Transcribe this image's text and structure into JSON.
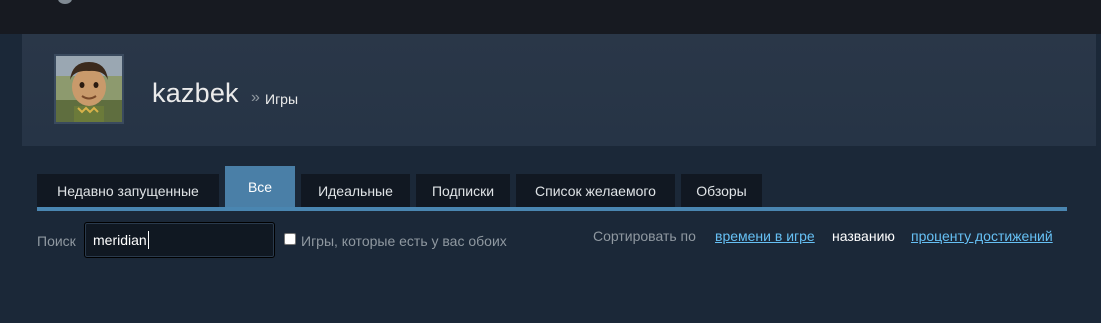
{
  "profile": {
    "persona_name": "kazbek",
    "breadcrumb_separator": "»",
    "page_title": "Игры"
  },
  "tabs": [
    {
      "label": "Недавно запущенные",
      "active": false
    },
    {
      "label": "Все",
      "active": true
    },
    {
      "label": "Идеальные",
      "active": false
    },
    {
      "label": "Подписки",
      "active": false
    },
    {
      "label": "Список желаемого",
      "active": false
    },
    {
      "label": "Обзоры",
      "active": false
    }
  ],
  "filter": {
    "search_label": "Поиск",
    "search_value": "meridian",
    "shared_checkbox_label": "Игры, которые есть у вас обоих",
    "shared_checked": false
  },
  "sort": {
    "label": "Сортировать по",
    "options": [
      {
        "label": "времени в игре",
        "current": false
      },
      {
        "label": "названию",
        "current": true
      },
      {
        "label": "проценту достижений",
        "current": false
      }
    ]
  },
  "colors": {
    "accent": "#66c0f4",
    "active_tab": "#4a7fa7",
    "background": "#1b2838"
  }
}
